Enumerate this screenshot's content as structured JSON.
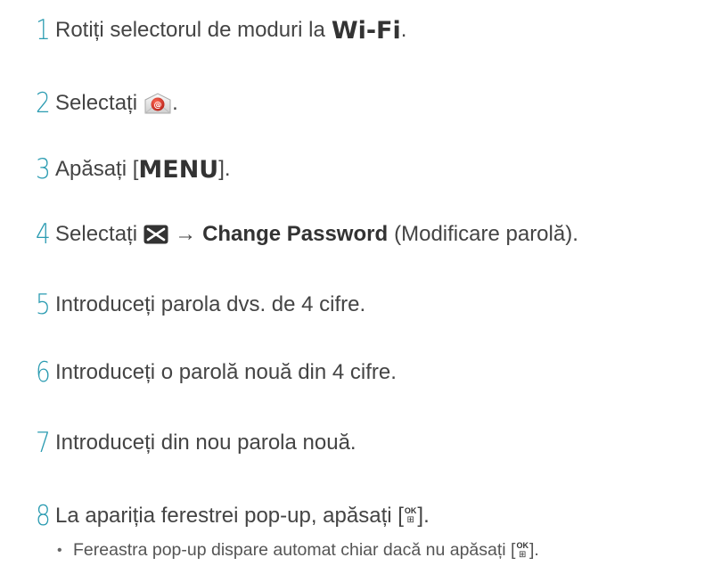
{
  "steps": [
    {
      "num": "1",
      "before": "Rotiți selectorul de moduri la",
      "highlight": "Wi-Fi",
      "after": "."
    },
    {
      "num": "2",
      "before": "Selectați",
      "icon": "email-app-icon",
      "after": "."
    },
    {
      "num": "3",
      "before": "Apăsați [",
      "highlight": "MENU",
      "after": "]."
    },
    {
      "num": "4",
      "before": "Selectați",
      "icon": "envelope-icon",
      "arrow": "→",
      "bold": "Change Password",
      "after": "(Modificare parolă)."
    },
    {
      "num": "5",
      "text": "Introduceți parola dvs. de 4 cifre."
    },
    {
      "num": "6",
      "text": "Introduceți o parolă nouă din 4 cifre."
    },
    {
      "num": "7",
      "text": "Introduceți din nou parola nouă."
    },
    {
      "num": "8",
      "before": "La apariția ferestrei pop-up, apăsați [",
      "key": "ok-button-icon",
      "after": "]."
    }
  ],
  "note": {
    "bullet": "•",
    "before": "Fereastra pop-up dispare automat chiar dacă nu apăsați [",
    "key": "ok-button-icon",
    "after": "]."
  },
  "ok_key": {
    "top": "OK",
    "bottom": "⊞"
  },
  "colors": {
    "number": "#2a9bb1",
    "text": "#444444",
    "email_icon": "#d23a2a"
  }
}
